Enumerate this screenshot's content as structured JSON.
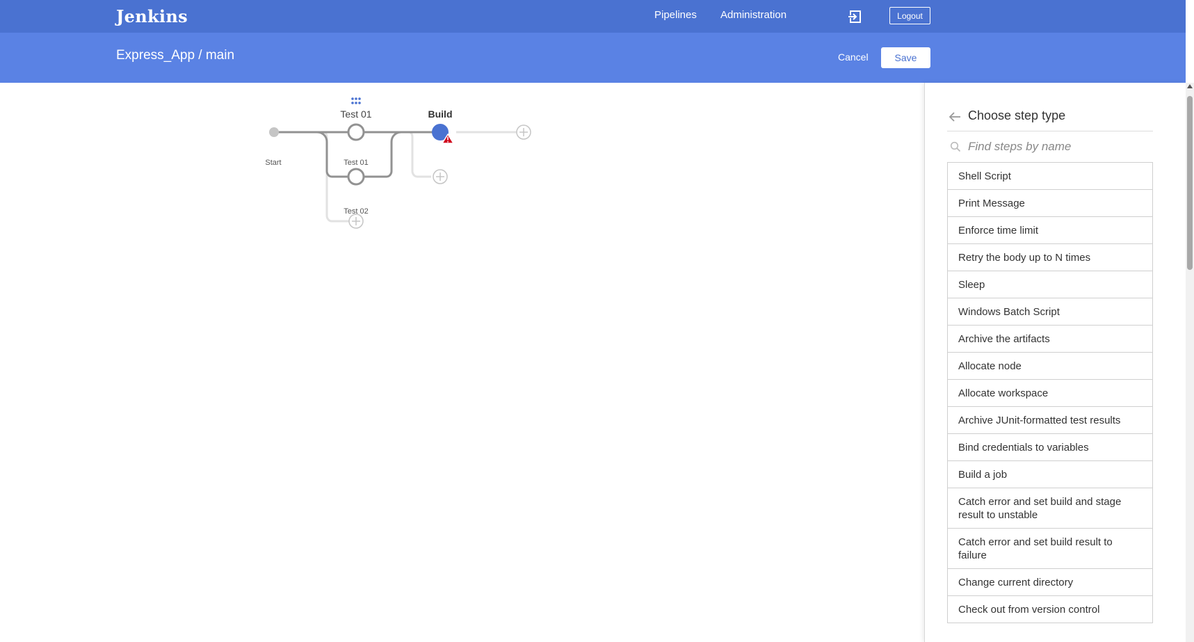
{
  "header": {
    "brand": "Jenkins",
    "nav": {
      "pipelines": "Pipelines",
      "administration": "Administration"
    },
    "logout": "Logout"
  },
  "subheader": {
    "title": "Express_App / main",
    "cancel": "Cancel",
    "save": "Save"
  },
  "pipeline": {
    "start_label": "Start",
    "stages": [
      {
        "title": "Test 01",
        "branches": [
          "Test 01",
          "Test 02"
        ]
      },
      {
        "title": "Build",
        "status": "warning"
      }
    ]
  },
  "panel": {
    "title": "Choose step type",
    "search_placeholder": "Find steps by name",
    "steps": [
      "Shell Script",
      "Print Message",
      "Enforce time limit",
      "Retry the body up to N times",
      "Sleep",
      "Windows Batch Script",
      "Archive the artifacts",
      "Allocate node",
      "Allocate workspace",
      "Archive JUnit-formatted test results",
      "Bind credentials to variables",
      "Build a job",
      "Catch error and set build and stage result to unstable",
      "Catch error and set build result to failure",
      "Change current directory",
      "Check out from version control"
    ]
  },
  "colors": {
    "top_bar": "#4a72d1",
    "sub_bar": "#5a82e4",
    "node_selected": "#4a72d1",
    "warning": "#d0021b"
  }
}
